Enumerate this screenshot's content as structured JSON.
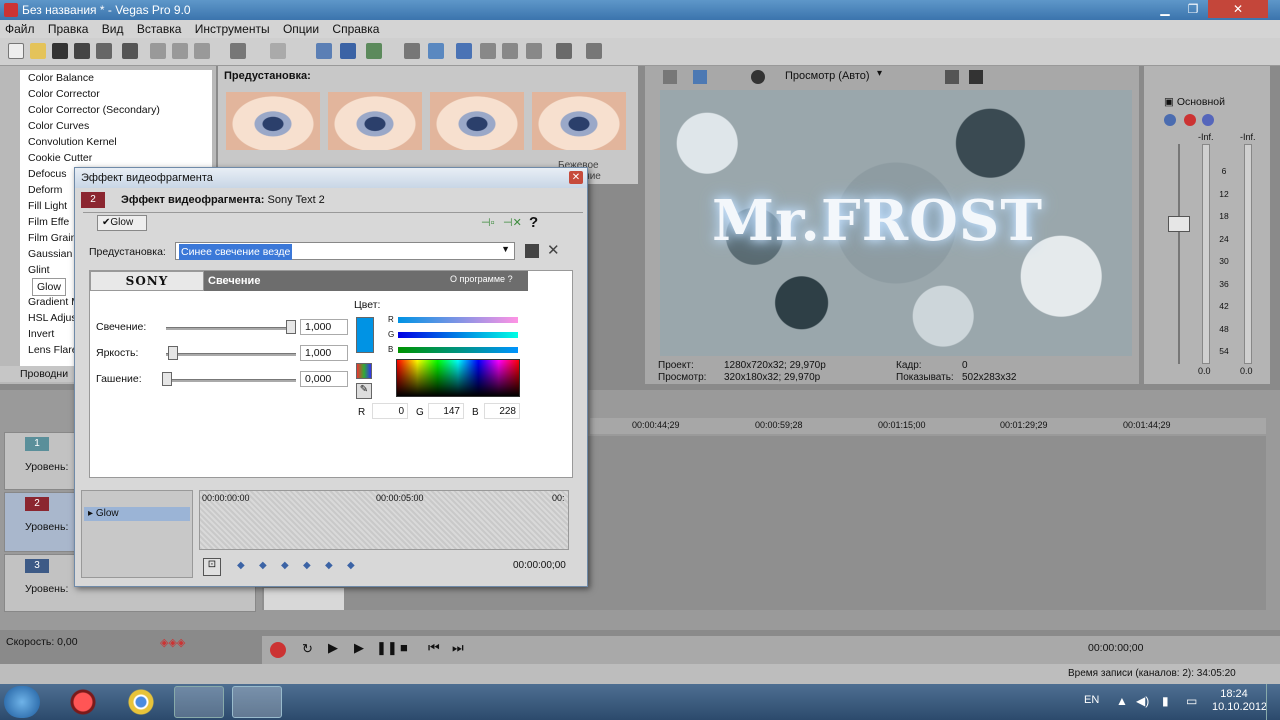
{
  "window": {
    "title": "Без названия * - Vegas Pro 9.0"
  },
  "menu": [
    "Файл",
    "Правка",
    "Вид",
    "Вставка",
    "Инструменты",
    "Опции",
    "Справка"
  ],
  "fx_list": [
    "Color Balance",
    "Color Corrector",
    "Color Corrector (Secondary)",
    "Color Curves",
    "Convolution Kernel",
    "Cookie Cutter",
    "Defocus",
    "Deform",
    "Fill Light",
    "Film Effe",
    "Film Grain",
    "Gaussian",
    "Glint",
    "Glow",
    "Gradient M",
    "HSL Adjus",
    "Invert",
    "Lens Flare"
  ],
  "fx_selected": "Glow",
  "fx_tab_label": "Проводни",
  "preset_panel": {
    "title": "Предустановка:",
    "labels": [
      "",
      "",
      "",
      "Бежевое свечение"
    ]
  },
  "preview": {
    "mode": "Просмотр (Авто)",
    "overlay_text": "Mr.FROST",
    "info": {
      "project_label": "Проект:",
      "project_value": "1280x720x32; 29,970p",
      "preview_label": "Просмотр:",
      "preview_value": "320x180x32; 29,970p",
      "frame_label": "Кадр:",
      "frame_value": "0",
      "display_label": "Показывать:",
      "display_value": "502x283x32"
    }
  },
  "mixer": {
    "title": "Основной",
    "inf_left": "-Inf.",
    "inf_right": "-Inf.",
    "scale": [
      "6",
      "12",
      "18",
      "24",
      "30",
      "36",
      "42",
      "48",
      "54"
    ],
    "val_left": "0.0",
    "val_right": "0.0"
  },
  "dialog": {
    "title": "Эффект видеофрагмента",
    "track_badge": "2",
    "header_label": "Эффект видеофрагмента:",
    "header_value": "Sony Text 2",
    "chain_item": "Glow",
    "help": "?",
    "preset_label": "Предустановка:",
    "preset_value": "Синее свечение везде",
    "brand": "SONY",
    "section_title": "Свечение",
    "about": "О программе",
    "about_q": "?",
    "params": [
      {
        "label": "Свечение:",
        "value": "1,000",
        "pos": 1.0
      },
      {
        "label": "Яркость:",
        "value": "1,000",
        "pos": 0.04
      },
      {
        "label": "Гашение:",
        "value": "0,000",
        "pos": 0.0
      }
    ],
    "color": {
      "label": "Цвет:",
      "hex": "#0093e4",
      "r_label": "R",
      "g_label": "G",
      "b_label": "B",
      "r": "0",
      "g": "147",
      "b": "228"
    },
    "keyframes": {
      "t0": "00:00:00:00",
      "t1": "00:00:05:00",
      "t2": "00:",
      "track": "Glow",
      "current": "00:00:00;00"
    }
  },
  "timeline": {
    "ticks": [
      "00:00:44;29",
      "00:00:59;28",
      "00:01:15;00",
      "00:01:29;29",
      "00:01:44;29"
    ],
    "tracks": [
      {
        "num": "1",
        "level": "Уровень:"
      },
      {
        "num": "2",
        "level": "Уровень:"
      },
      {
        "num": "3",
        "level": "Уровень:"
      }
    ],
    "speed": "Скорость: 0,00",
    "time": "00:00:00;00",
    "record_time": "Время записи (каналов: 2): 34:05:20"
  },
  "taskbar": {
    "lang": "EN",
    "time": "18:24",
    "date": "10.10.2012"
  },
  "colors": {
    "accent_blue": "#0093e4",
    "title_blue": "#3b74ad"
  }
}
